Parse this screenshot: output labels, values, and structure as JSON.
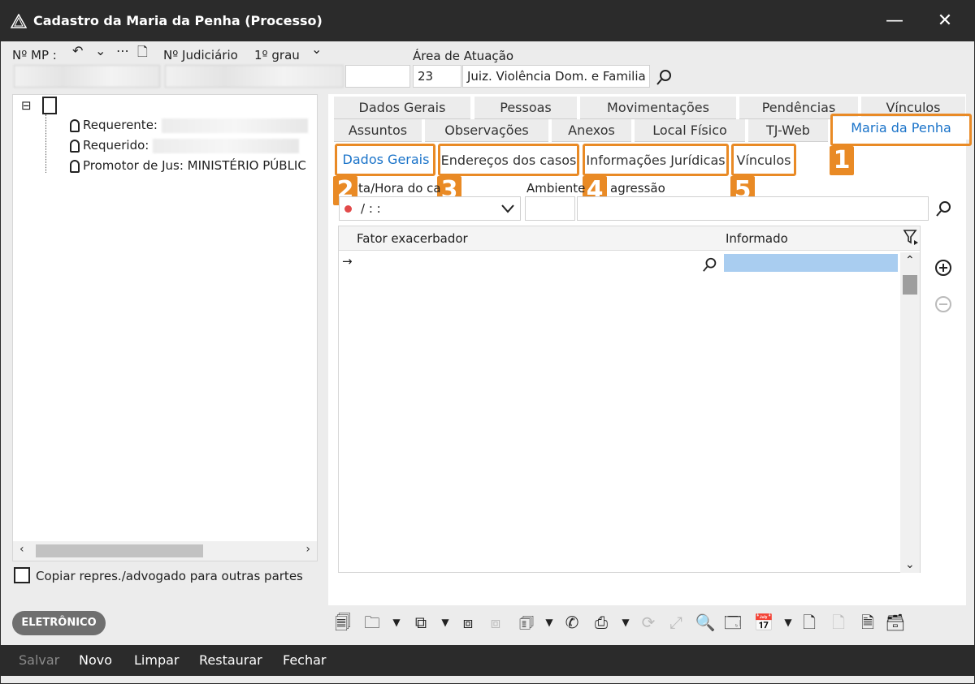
{
  "window": {
    "title": "Cadastro da Maria da Penha (Processo)",
    "minimize": "—",
    "close": "✕"
  },
  "header": {
    "mp_label": "Nº MP :",
    "judiciario_label": "Nº Judiciário",
    "grau_label": "1º grau",
    "area_label": "Área de Atuação",
    "area_code": "23",
    "area_name": "Juiz. Violência Dom. e Familia"
  },
  "tree": {
    "collapse": "⊟",
    "items": [
      {
        "label": "Requerente:"
      },
      {
        "label": "Requerido:"
      },
      {
        "label": "Promotor de Jus: MINISTÉRIO PÚBLIC"
      }
    ]
  },
  "copy_checkbox_label": "Copiar repres./advogado para outras partes",
  "eletronico_badge": "ELETRÔNICO",
  "tabs_row1": [
    "Dados Gerais",
    "Pessoas",
    "Movimentações",
    "Pendências",
    "Vínculos"
  ],
  "tabs_row2": [
    "Assuntos",
    "Observações",
    "Anexos",
    "Local Físico",
    "TJ-Web",
    "Maria da Penha"
  ],
  "subtabs": [
    "Dados Gerais",
    "Endereços dos casos",
    "Informações Jurídicas",
    "Vínculos"
  ],
  "callouts": [
    "1",
    "2",
    "3",
    "4",
    "5"
  ],
  "form": {
    "datahora_label": "ta/Hora do ca",
    "datahora_value": "/      : :",
    "ambiente_label_a": "Ambiente",
    "ambiente_label_b": "agressão"
  },
  "grid": {
    "col_fator": "Fator exacerbador",
    "col_informado": "Informado",
    "row_marker": "→"
  },
  "footer": {
    "salvar": "Salvar",
    "novo": "Novo",
    "limpar": "Limpar",
    "restaurar": "Restaurar",
    "fechar": "Fechar"
  },
  "colors": {
    "accent_orange": "#e98a25",
    "active_tab_blue": "#1a73c9",
    "titlebar": "#2b2b2b"
  }
}
